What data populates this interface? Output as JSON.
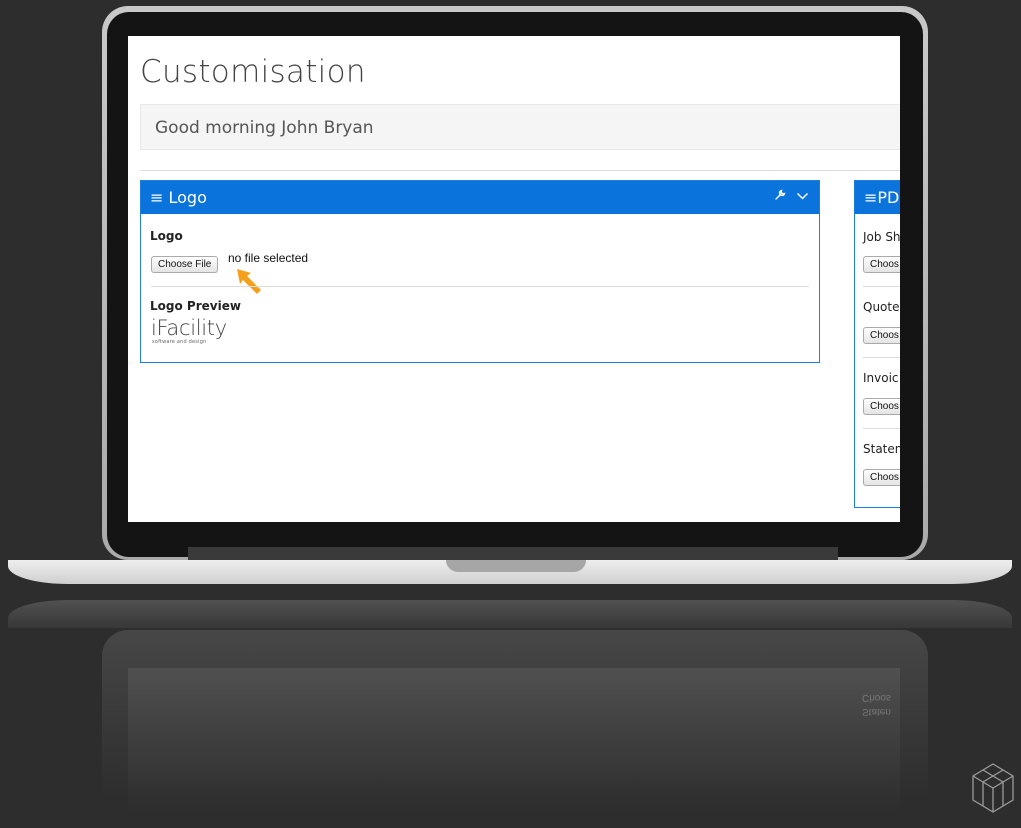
{
  "page": {
    "title": "Customisation",
    "greeting": "Good morning John Bryan"
  },
  "logo_panel": {
    "header_icon": "hamburger-menu-icon",
    "header_title": "Logo",
    "tool_icons": [
      "wrench-icon",
      "chevron-down-icon"
    ],
    "field_label": "Logo",
    "choose_button": "Choose File",
    "file_status": "no file selected",
    "preview_label": "Logo Preview",
    "preview_brand": "iFacility",
    "preview_tagline": "software and design"
  },
  "pdf_panel": {
    "header_title": "PD",
    "rows": [
      {
        "label": "Job Sh",
        "button": "Choos"
      },
      {
        "label": "Quote",
        "button": "Choos"
      },
      {
        "label": "Invoic",
        "button": "Choos"
      },
      {
        "label": "Staten",
        "button": "Choos"
      }
    ]
  },
  "reflection": {
    "line1": "Choos",
    "line2": "Staten"
  },
  "colors": {
    "panel_header": "#0a74dc",
    "arrow": "#f5a01a"
  }
}
